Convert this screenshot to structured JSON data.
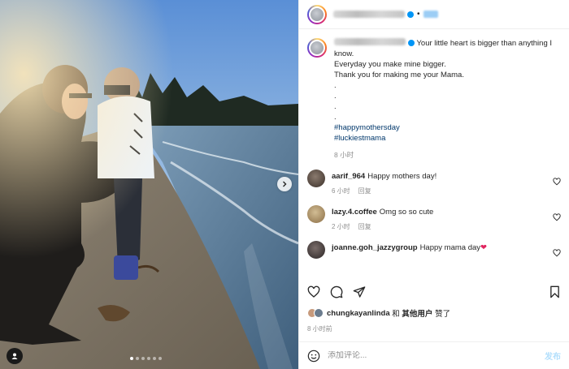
{
  "post": {
    "author_handle_obscured": "jennifer.tsang.ying",
    "caption_lines": [
      "Your little heart is bigger than anything I know.",
      "Everyday you make mine bigger.",
      "Thank you for making me your Mama.",
      ".",
      ".",
      ".",
      "."
    ],
    "hashtags": [
      "#happymothersday",
      "#luckiestmama"
    ],
    "caption_time": "8 小时"
  },
  "comments": [
    {
      "username": "aarif_964",
      "text": "Happy mothers day!",
      "time": "6 小时",
      "reply": "回复",
      "avatar_color": "#5b4a3f"
    },
    {
      "username": "lazy.4.coffee",
      "text": "Omg so so cute",
      "time": "2 小时",
      "reply": "回复",
      "avatar_color": "#a88f6a"
    },
    {
      "username": "joanne.goh_jazzygroup",
      "text": "Happy mama day",
      "emoji": "❤",
      "time": "",
      "reply": "",
      "avatar_color": "#3f3a3a"
    }
  ],
  "likes": {
    "first_user": "chungkayanlinda",
    "connector": "和",
    "others": "其他用户",
    "suffix": "赞了"
  },
  "post_time": "8 小时前",
  "composer": {
    "placeholder": "添加评论...",
    "post_label": "发布"
  },
  "colors": {
    "link": "#00376b",
    "accent": "#0095f6",
    "muted": "#8e8e8e",
    "emoji_heart": "#e0245e"
  },
  "icons": {
    "header_avatar": "story-ring-avatar",
    "verified": "verified-badge-icon",
    "like": "heart-icon",
    "comment": "comment-bubble-icon",
    "share": "paper-plane-icon",
    "save": "bookmark-icon",
    "emoji": "smiley-icon",
    "tag": "user-tag-icon",
    "next": "chevron-right-icon"
  },
  "carousel": {
    "slides": 6,
    "active_index": 0
  }
}
